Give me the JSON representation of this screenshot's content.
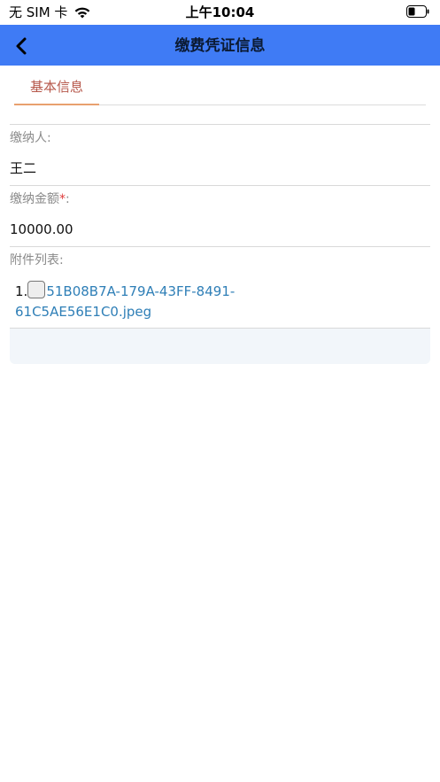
{
  "status_bar": {
    "carrier": "无 SIM 卡",
    "time": "上午10:04"
  },
  "header": {
    "title": "缴费凭证信息"
  },
  "tabs": [
    {
      "label": "基本信息",
      "active": true
    }
  ],
  "form": {
    "payer": {
      "label": "缴纳人:",
      "value": "王二"
    },
    "amount": {
      "label": "缴纳金额",
      "required_mark": "*",
      "label_suffix": ":",
      "value": "10000.00"
    },
    "attachments": {
      "label": "附件列表:",
      "items": [
        {
          "index": "1.",
          "filename_line1": "51B08B7A-179A-43FF-8491-",
          "filename_line2": "61C5AE56E1C0.jpeg"
        }
      ]
    }
  },
  "colors": {
    "nav_bar": "#3f7bf5",
    "tab_active_text": "#b6574a",
    "tab_underline": "#e8a06f",
    "link": "#2f7fb7",
    "required": "#e03c3c"
  },
  "icons": {
    "back": "chevron-left-icon",
    "wifi": "wifi-icon",
    "battery": "battery-icon"
  }
}
